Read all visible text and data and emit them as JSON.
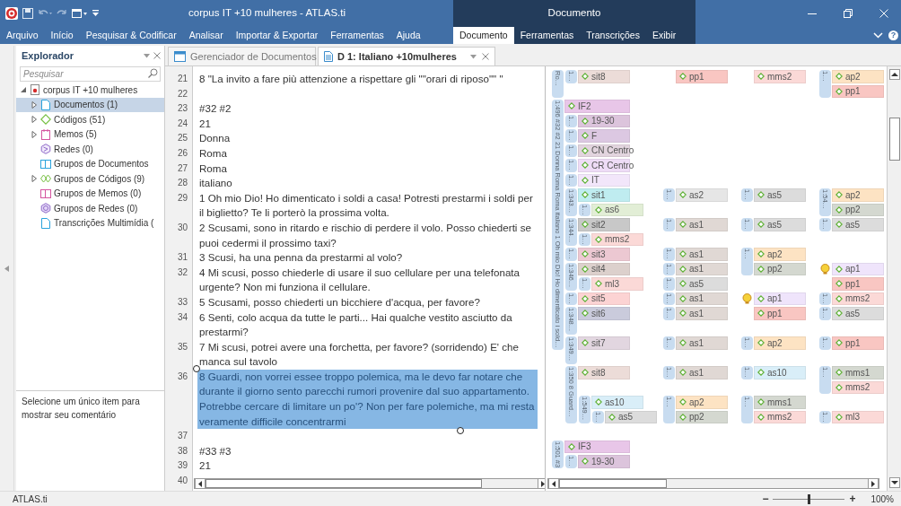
{
  "window": {
    "title": "corpus IT +10 mulheres - ATLAS.ti",
    "context_title": "Documento",
    "help": "?"
  },
  "ribbon_tabs": [
    {
      "label": "Arquivo",
      "kind": "main",
      "selected": false
    },
    {
      "label": "Início",
      "kind": "main",
      "selected": false
    },
    {
      "label": "Pesquisar & Codificar",
      "kind": "main",
      "selected": false
    },
    {
      "label": "Analisar",
      "kind": "main",
      "selected": false
    },
    {
      "label": "Importar & Exportar",
      "kind": "main",
      "selected": false
    },
    {
      "label": "Ferramentas",
      "kind": "main",
      "selected": false
    },
    {
      "label": "Ajuda",
      "kind": "main",
      "selected": false
    },
    {
      "label": "Documento",
      "kind": "context",
      "selected": true
    },
    {
      "label": "Ferramentas",
      "kind": "context",
      "selected": false
    },
    {
      "label": "Transcrições",
      "kind": "context",
      "selected": false
    },
    {
      "label": "Exibir",
      "kind": "context",
      "selected": false
    }
  ],
  "explorer": {
    "title": "Explorador",
    "search": {
      "placeholder": "Pesquisar"
    },
    "tree": [
      {
        "label": "corpus IT +10 mulheres",
        "kind": "project",
        "expanded": true,
        "selected": false,
        "children": [
          {
            "label": "Documentos (1)",
            "kind": "document",
            "expanded": false,
            "selected": true
          },
          {
            "label": "Códigos (51)",
            "kind": "code",
            "expanded": false,
            "selected": false
          },
          {
            "label": "Memos (5)",
            "kind": "memo",
            "expanded": false,
            "selected": false
          },
          {
            "label": "Redes (0)",
            "kind": "network",
            "selected": false
          },
          {
            "label": "Grupos de Documentos",
            "kind": "docgroup",
            "selected": false
          },
          {
            "label": "Grupos de Códigos (9)",
            "kind": "codegroup",
            "expanded": false,
            "selected": false
          },
          {
            "label": "Grupos de Memos (0)",
            "kind": "memogroup",
            "selected": false
          },
          {
            "label": "Grupos de Redes (0)",
            "kind": "networkgroup",
            "selected": false
          },
          {
            "label": "Transcrições Multimídia (",
            "kind": "transcript",
            "selected": false
          }
        ]
      }
    ],
    "comment": "Selecione um único item para mostrar seu comentário"
  },
  "document_tabs": [
    {
      "label": "Gerenciador de Documentos",
      "kind": "manager",
      "selected": false
    },
    {
      "label": "D 1: Italiano +10mulheres",
      "kind": "document",
      "selected": true
    }
  ],
  "document": {
    "lines": [
      {
        "number": "21",
        "text": "8 \"La invito a fare più attenzione a rispettare gli \"\"orari di riposo\"\" \"",
        "selected": false
      },
      {
        "number": "22",
        "selected": false
      },
      {
        "number": "23",
        "text": "#32 #2",
        "selected": false
      },
      {
        "number": "24",
        "text": "21",
        "selected": false
      },
      {
        "number": "25",
        "text": "Donna",
        "selected": false
      },
      {
        "number": "26",
        "text": "Roma",
        "selected": false
      },
      {
        "number": "27",
        "text": "Roma",
        "selected": false
      },
      {
        "number": "28",
        "text": "italiano",
        "selected": false
      },
      {
        "number": "29",
        "text": "1 Oh mio Dio! Ho dimenticato i soldi a casa! Potresti prestarmi i soldi per il biglietto? Te li porterò la prossima volta.",
        "selected": false
      },
      {
        "number": "30",
        "text": "2 Scusami, sono in ritardo e rischio di perdere il volo. Posso chiederti se puoi cedermi il prossimo taxi?",
        "selected": false
      },
      {
        "number": "31",
        "text": "3 Scusi, ha una penna da prestarmi al volo?",
        "selected": false
      },
      {
        "number": "32",
        "text": "4 Mi scusi, posso chiederle di usare il suo cellulare per una telefonata urgente? Non mi funziona il cellulare.",
        "selected": false
      },
      {
        "number": "33",
        "text": "5 Scusami, posso chiederti un bicchiere d'acqua, per favore?",
        "selected": false
      },
      {
        "number": "34",
        "text": "6 Senti, colo acqua da tutte le parti... Hai qualche vestito asciutto da prestarmi?",
        "selected": false
      },
      {
        "number": "35",
        "text": "7 Mi scusi, potrei avere una forchetta, per favore? (sorridendo) E' che manca sul tavolo",
        "selected": false
      },
      {
        "number": "36",
        "text": "8 Guardi, non vorrei essee troppo polemica, ma le devo far notare che durante il giorno sento parecchi rumori provenire dal suo appartamento. Potrebbe cercare di limitare un po'? Non per fare polemiche, ma mi resta veramente difficile concentrarmi",
        "selected": true
      },
      {
        "number": "37",
        "selected": false
      },
      {
        "number": "38",
        "text": "#33 #3",
        "selected": false
      },
      {
        "number": "39",
        "text": "21",
        "selected": false
      },
      {
        "number": "40",
        "selected": false
      }
    ]
  },
  "margin": {
    "rows": [
      {
        "quote": {
          "label": "Ro…"
        },
        "cells": [
          {
            "kind": "quote",
            "label": "1…",
            "codes": [
              {
                "name": "sit8",
                "color": "#ecdcd8"
              }
            ]
          },
          {
            "kind": "plain",
            "codes": [
              {
                "name": "pp1",
                "color": "#f9c6c2"
              }
            ]
          },
          {
            "kind": "plain",
            "codes": [
              {
                "name": "mms2",
                "color": "#fbd9d7"
              }
            ]
          },
          {
            "kind": "quote",
            "label": "1…",
            "codes": [
              {
                "name": "ap2",
                "color": "#fde3c3"
              },
              {
                "name": "pp1",
                "color": "#f9c6c2"
              }
            ]
          }
        ]
      },
      {
        "cells": [
          null,
          null,
          null,
          null
        ]
      },
      {
        "quote": {
          "label": "1:496 #32 #2 21 Donna Roma Roma italiano 1 Oh mio Dio! Ho dimenticato i sold…"
        },
        "cells": [
          {
            "kind": "plain",
            "codes": [
              {
                "name": "IF2",
                "color": "#e8c6e8"
              }
            ]
          },
          null,
          null,
          null
        ]
      },
      {
        "cells": [
          {
            "kind": "quote",
            "label": "1…",
            "codes": [
              {
                "name": "19-30",
                "color": "#dcc4dc"
              }
            ]
          },
          null,
          null,
          null
        ]
      },
      {
        "cells": [
          {
            "kind": "quote",
            "label": "1…",
            "codes": [
              {
                "name": "F",
                "color": "#dcc8e2"
              }
            ]
          },
          null,
          null,
          null
        ]
      },
      {
        "cells": [
          {
            "kind": "quote",
            "label": "1…",
            "codes": [
              {
                "name": "CN Centro",
                "color": "#e2d4de"
              }
            ]
          },
          null,
          null,
          null
        ]
      },
      {
        "cells": [
          {
            "kind": "quote",
            "label": "1…",
            "codes": [
              {
                "name": "CR Centro",
                "color": "#eedcf6"
              }
            ]
          },
          null,
          null,
          null
        ]
      },
      {
        "cells": [
          {
            "kind": "quote",
            "label": "1…",
            "codes": [
              {
                "name": "IT",
                "color": "#f2e6fa"
              }
            ]
          },
          null,
          null,
          null
        ]
      },
      {
        "cells": [
          {
            "kind": "quote",
            "label": "1:343…",
            "codes": [
              {
                "name": "sit1",
                "color": "#bfecf0"
              }
            ]
          },
          {
            "kind": "quote",
            "label": "1…",
            "codes": [
              {
                "name": "as2",
                "color": "#e6e6e6"
              }
            ]
          },
          {
            "kind": "quote",
            "label": "1…",
            "codes": [
              {
                "name": "as5",
                "color": "#dcdcdc"
              }
            ]
          },
          {
            "kind": "quote",
            "label": "1:54…",
            "codes": [
              {
                "name": "ap2",
                "color": "#fde3c3"
              },
              {
                "name": "pp2",
                "color": "#d4d8d0"
              }
            ]
          }
        ]
      },
      {
        "cells": [
          {
            "kind": "nested",
            "label": "1…",
            "codes": [
              {
                "name": "as6",
                "color": "#e2eed6"
              }
            ]
          },
          null,
          null,
          null
        ]
      },
      {
        "cells": [
          {
            "kind": "quote",
            "label": "1:344…",
            "codes": [
              {
                "name": "sit2",
                "color": "#c8c8c8"
              }
            ]
          },
          {
            "kind": "quote",
            "label": "1…",
            "codes": [
              {
                "name": "as1",
                "color": "#e0d8d4"
              }
            ]
          },
          {
            "kind": "quote",
            "label": "1…",
            "codes": [
              {
                "name": "as5",
                "color": "#dcdcdc"
              }
            ]
          },
          {
            "kind": "quote",
            "label": "1…",
            "codes": [
              {
                "name": "as5",
                "color": "#dcdcdc"
              }
            ]
          }
        ]
      },
      {
        "cells": [
          {
            "kind": "nested",
            "label": "1…",
            "codes": [
              {
                "name": "mms2",
                "color": "#fbd9d7"
              }
            ]
          },
          null,
          null,
          null
        ]
      },
      {
        "cells": [
          {
            "kind": "quote",
            "label": "1…",
            "codes": [
              {
                "name": "sit3",
                "color": "#ecc8d2"
              }
            ]
          },
          {
            "kind": "quote",
            "label": "1…",
            "codes": [
              {
                "name": "as1",
                "color": "#e0d8d4"
              }
            ]
          },
          {
            "kind": "quote",
            "label": "1…",
            "codes": [
              {
                "name": "ap2",
                "color": "#fde3c3"
              },
              {
                "name": "pp2",
                "color": "#d4d8d0"
              }
            ]
          },
          null
        ]
      },
      {
        "cells": [
          {
            "kind": "quote",
            "label": "1:346…",
            "codes": [
              {
                "name": "sit4",
                "color": "#dcd0cc"
              }
            ]
          },
          {
            "kind": "quote",
            "label": "1…",
            "codes": [
              {
                "name": "as1",
                "color": "#e0d8d4"
              }
            ]
          },
          null,
          {
            "kind": "memo",
            "codes": [
              {
                "name": "ap1",
                "color": "#efe4fb"
              },
              {
                "name": "pp1",
                "color": "#f9c6c2"
              }
            ]
          }
        ]
      },
      {
        "cells": [
          {
            "kind": "nested",
            "label": "1…",
            "codes": [
              {
                "name": "ml3",
                "color": "#fbd9d7"
              }
            ]
          },
          {
            "kind": "quote",
            "label": "1…",
            "codes": [
              {
                "name": "as5",
                "color": "#dcdcdc"
              }
            ]
          },
          null,
          null
        ]
      },
      {
        "cells": [
          {
            "kind": "quote",
            "label": "1…",
            "codes": [
              {
                "name": "sit5",
                "color": "#fcd3d3"
              }
            ]
          },
          {
            "kind": "quote",
            "label": "1…",
            "codes": [
              {
                "name": "as1",
                "color": "#e0d8d4"
              }
            ]
          },
          {
            "kind": "memo",
            "codes": [
              {
                "name": "ap1",
                "color": "#efe4fb"
              },
              {
                "name": "pp1",
                "color": "#f9c6c2"
              }
            ]
          },
          {
            "kind": "quote",
            "label": "1…",
            "codes": [
              {
                "name": "mms2",
                "color": "#fbd9d7"
              }
            ]
          }
        ]
      },
      {
        "cells": [
          {
            "kind": "quote",
            "label": "1:348…",
            "codes": [
              {
                "name": "sit6",
                "color": "#cacbdc"
              }
            ]
          },
          {
            "kind": "quote",
            "label": "1…",
            "codes": [
              {
                "name": "as1",
                "color": "#e0d8d4"
              }
            ]
          },
          null,
          {
            "kind": "quote",
            "label": "1…",
            "codes": [
              {
                "name": "as5",
                "color": "#dcdcdc"
              }
            ]
          }
        ]
      },
      {
        "cells": [
          null,
          null,
          null,
          null
        ]
      },
      {
        "cells": [
          {
            "kind": "quote",
            "label": "1:349…",
            "codes": [
              {
                "name": "sit7",
                "color": "#e2d6e0"
              }
            ]
          },
          {
            "kind": "quote",
            "label": "1…",
            "codes": [
              {
                "name": "as1",
                "color": "#e0d8d4"
              }
            ]
          },
          {
            "kind": "quote",
            "label": "1…",
            "codes": [
              {
                "name": "ap2",
                "color": "#fde3c3"
              }
            ]
          },
          {
            "kind": "quote",
            "label": "1…",
            "codes": [
              {
                "name": "pp1",
                "color": "#f9c6c2"
              }
            ]
          }
        ]
      },
      {
        "cells": [
          null,
          null,
          null,
          null
        ]
      },
      {
        "cells": [
          {
            "kind": "quote",
            "label": "1:350 8 Guard…",
            "codes": [
              {
                "name": "sit8",
                "color": "#ecdcd8"
              }
            ]
          },
          {
            "kind": "quote",
            "label": "1…",
            "codes": [
              {
                "name": "as1",
                "color": "#e0d8d4"
              }
            ]
          },
          {
            "kind": "quote",
            "label": "1…",
            "codes": [
              {
                "name": "as10",
                "color": "#d9eef8"
              }
            ]
          },
          {
            "kind": "quote",
            "label": "1…",
            "codes": [
              {
                "name": "mms1",
                "color": "#d4d8d0"
              },
              {
                "name": "mms2",
                "color": "#fbd9d7"
              }
            ]
          }
        ]
      },
      {
        "cells": [
          null,
          null,
          null,
          null
        ]
      },
      {
        "cells": [
          {
            "kind": "nested",
            "label": "1:549…",
            "codes": [
              {
                "name": "as10",
                "color": "#d9eef8"
              }
            ]
          },
          {
            "kind": "quote",
            "label": "1…",
            "codes": [
              {
                "name": "ap2",
                "color": "#fde3c3"
              },
              {
                "name": "pp2",
                "color": "#d4d8d0"
              }
            ]
          },
          {
            "kind": "quote",
            "label": "1…",
            "codes": [
              {
                "name": "mms1",
                "color": "#d4d8d0"
              },
              {
                "name": "mms2",
                "color": "#fbd9d7"
              }
            ]
          },
          null
        ]
      },
      {
        "cells": [
          {
            "kind": "nested2",
            "label": "1…",
            "codes": [
              {
                "name": "as5",
                "color": "#dcdcdc"
              }
            ]
          },
          null,
          null,
          {
            "kind": "quote",
            "label": "1…",
            "codes": [
              {
                "name": "ml3",
                "color": "#fbd9d7"
              }
            ]
          }
        ]
      },
      {
        "cells": [
          null,
          null,
          null,
          null
        ]
      },
      {
        "quote": {
          "label": "1:501 #3"
        },
        "cells": [
          {
            "kind": "plain",
            "codes": [
              {
                "name": "IF3",
                "color": "#e8c6e8"
              }
            ]
          },
          null,
          null,
          null
        ]
      },
      {
        "cells": [
          {
            "kind": "quote",
            "label": "1…",
            "codes": [
              {
                "name": "19-30",
                "color": "#dcc4dc"
              }
            ]
          },
          null,
          null,
          null
        ]
      }
    ]
  },
  "status_bar": {
    "text": "ATLAS.ti",
    "zoom": {
      "minus": "−",
      "plus": "+",
      "level": 0.5,
      "reading": "100%"
    }
  }
}
